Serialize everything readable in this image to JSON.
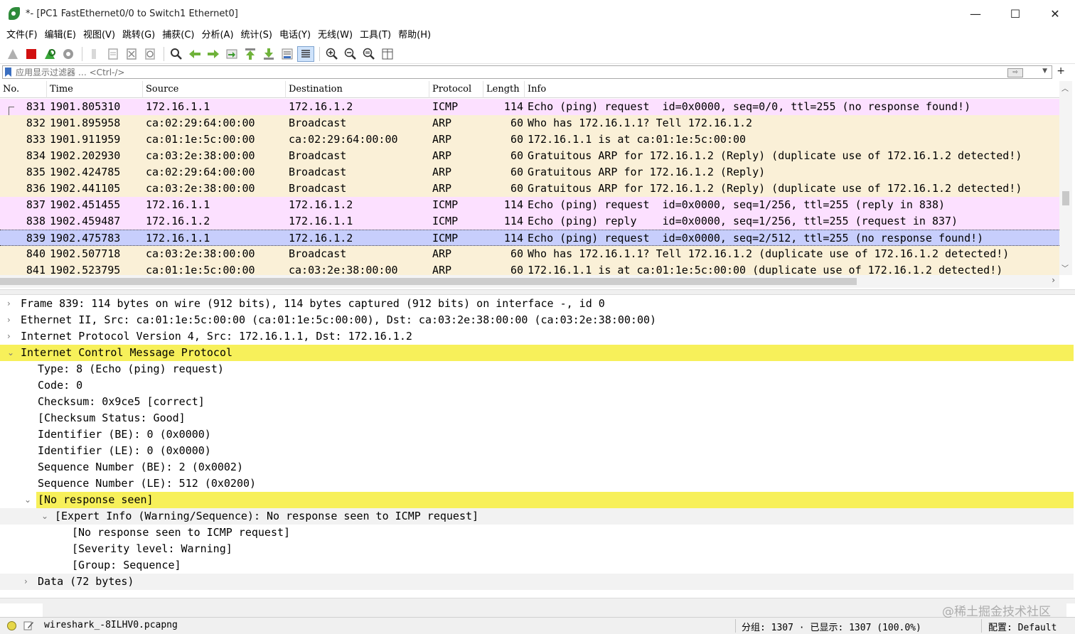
{
  "window": {
    "title": "*- [PC1 FastEthernet0/0 to Switch1 Ethernet0]",
    "minimize": "—",
    "maximize": "☐",
    "close": "✕"
  },
  "menu": [
    {
      "label": "文件(F)"
    },
    {
      "label": "编辑(E)"
    },
    {
      "label": "视图(V)"
    },
    {
      "label": "跳转(G)"
    },
    {
      "label": "捕获(C)"
    },
    {
      "label": "分析(A)"
    },
    {
      "label": "统计(S)"
    },
    {
      "label": "电话(Y)"
    },
    {
      "label": "无线(W)"
    },
    {
      "label": "工具(T)"
    },
    {
      "label": "帮助(H)"
    }
  ],
  "filter": {
    "placeholder": "应用显示过滤器 … <Ctrl-/>",
    "plus": "+"
  },
  "columns": {
    "no": "No.",
    "time": "Time",
    "source": "Source",
    "destination": "Destination",
    "protocol": "Protocol",
    "length": "Length",
    "info": "Info"
  },
  "packets": [
    {
      "no": "831",
      "time": "1901.805310",
      "src": "172.16.1.1",
      "dst": "172.16.1.2",
      "proto": "ICMP",
      "len": "114",
      "info": "Echo (ping) request  id=0x0000, seq=0/0, ttl=255 (no response found!)",
      "kind": "icmp"
    },
    {
      "no": "832",
      "time": "1901.895958",
      "src": "ca:02:29:64:00:00",
      "dst": "Broadcast",
      "proto": "ARP",
      "len": "60",
      "info": "Who has 172.16.1.1? Tell 172.16.1.2",
      "kind": "arp"
    },
    {
      "no": "833",
      "time": "1901.911959",
      "src": "ca:01:1e:5c:00:00",
      "dst": "ca:02:29:64:00:00",
      "proto": "ARP",
      "len": "60",
      "info": "172.16.1.1 is at ca:01:1e:5c:00:00",
      "kind": "arp"
    },
    {
      "no": "834",
      "time": "1902.202930",
      "src": "ca:03:2e:38:00:00",
      "dst": "Broadcast",
      "proto": "ARP",
      "len": "60",
      "info": "Gratuitous ARP for 172.16.1.2 (Reply) (duplicate use of 172.16.1.2 detected!)",
      "kind": "arp"
    },
    {
      "no": "835",
      "time": "1902.424785",
      "src": "ca:02:29:64:00:00",
      "dst": "Broadcast",
      "proto": "ARP",
      "len": "60",
      "info": "Gratuitous ARP for 172.16.1.2 (Reply)",
      "kind": "arp"
    },
    {
      "no": "836",
      "time": "1902.441105",
      "src": "ca:03:2e:38:00:00",
      "dst": "Broadcast",
      "proto": "ARP",
      "len": "60",
      "info": "Gratuitous ARP for 172.16.1.2 (Reply) (duplicate use of 172.16.1.2 detected!)",
      "kind": "arp"
    },
    {
      "no": "837",
      "time": "1902.451455",
      "src": "172.16.1.1",
      "dst": "172.16.1.2",
      "proto": "ICMP",
      "len": "114",
      "info": "Echo (ping) request  id=0x0000, seq=1/256, ttl=255 (reply in 838)",
      "kind": "icmp"
    },
    {
      "no": "838",
      "time": "1902.459487",
      "src": "172.16.1.2",
      "dst": "172.16.1.1",
      "proto": "ICMP",
      "len": "114",
      "info": "Echo (ping) reply    id=0x0000, seq=1/256, ttl=255 (request in 837)",
      "kind": "icmp"
    },
    {
      "no": "839",
      "time": "1902.475783",
      "src": "172.16.1.1",
      "dst": "172.16.1.2",
      "proto": "ICMP",
      "len": "114",
      "info": "Echo (ping) request  id=0x0000, seq=2/512, ttl=255 (no response found!)",
      "kind": "sel"
    },
    {
      "no": "840",
      "time": "1902.507718",
      "src": "ca:03:2e:38:00:00",
      "dst": "Broadcast",
      "proto": "ARP",
      "len": "60",
      "info": "Who has 172.16.1.1? Tell 172.16.1.2 (duplicate use of 172.16.1.2 detected!)",
      "kind": "arp"
    },
    {
      "no": "841",
      "time": "1902.523795",
      "src": "ca:01:1e:5c:00:00",
      "dst": "ca:03:2e:38:00:00",
      "proto": "ARP",
      "len": "60",
      "info": "172.16.1.1 is at ca:01:1e:5c:00:00 (duplicate use of 172.16.1.2 detected!)",
      "kind": "arp"
    }
  ],
  "details": [
    {
      "text": "Frame 839: 114 bytes on wire (912 bits), 114 bytes captured (912 bits) on interface -, id 0",
      "level": 0,
      "arrow": "›",
      "style": ""
    },
    {
      "text": "Ethernet II, Src: ca:01:1e:5c:00:00 (ca:01:1e:5c:00:00), Dst: ca:03:2e:38:00:00 (ca:03:2e:38:00:00)",
      "level": 0,
      "arrow": "›",
      "style": ""
    },
    {
      "text": "Internet Protocol Version 4, Src: 172.16.1.1, Dst: 172.16.1.2",
      "level": 0,
      "arrow": "›",
      "style": ""
    },
    {
      "text": "Internet Control Message Protocol",
      "level": 0,
      "arrow": "⌄",
      "style": "hlfull"
    },
    {
      "text": "Type: 8 (Echo (ping) request)",
      "level": 1,
      "arrow": "",
      "style": ""
    },
    {
      "text": "Code: 0",
      "level": 1,
      "arrow": "",
      "style": ""
    },
    {
      "text": "Checksum: 0x9ce5 [correct]",
      "level": 1,
      "arrow": "",
      "style": ""
    },
    {
      "text": "[Checksum Status: Good]",
      "level": 1,
      "arrow": "",
      "style": ""
    },
    {
      "text": "Identifier (BE): 0 (0x0000)",
      "level": 1,
      "arrow": "",
      "style": ""
    },
    {
      "text": "Identifier (LE): 0 (0x0000)",
      "level": 1,
      "arrow": "",
      "style": ""
    },
    {
      "text": "Sequence Number (BE): 2 (0x0002)",
      "level": 1,
      "arrow": "",
      "style": ""
    },
    {
      "text": "Sequence Number (LE): 512 (0x0200)",
      "level": 1,
      "arrow": "",
      "style": ""
    },
    {
      "text": "[No response seen]",
      "level": 1,
      "arrow": "⌄",
      "style": "hlrow"
    },
    {
      "text": "[Expert Info (Warning/Sequence): No response seen to ICMP request]",
      "level": 2,
      "arrow": "⌄",
      "style": "alt"
    },
    {
      "text": "[No response seen to ICMP request]",
      "level": 3,
      "arrow": "",
      "style": ""
    },
    {
      "text": "[Severity level: Warning]",
      "level": 3,
      "arrow": "",
      "style": ""
    },
    {
      "text": "[Group: Sequence]",
      "level": 3,
      "arrow": "",
      "style": ""
    },
    {
      "text": "Data (72 bytes)",
      "level": 1,
      "arrow": "›",
      "style": "alt"
    }
  ],
  "status": {
    "file": "wireshark_-8ILHV0.pcapng",
    "stats": "分组: 1307 · 已显示: 1307 (100.0%)",
    "profile": "配置: Default"
  },
  "watermark": "@稀土掘金技术社区",
  "colors": {
    "icmp_row": "#fce0ff",
    "arp_row": "#faf0d7",
    "selected_row": "#c7cefc",
    "highlight": "#f7f05a"
  }
}
